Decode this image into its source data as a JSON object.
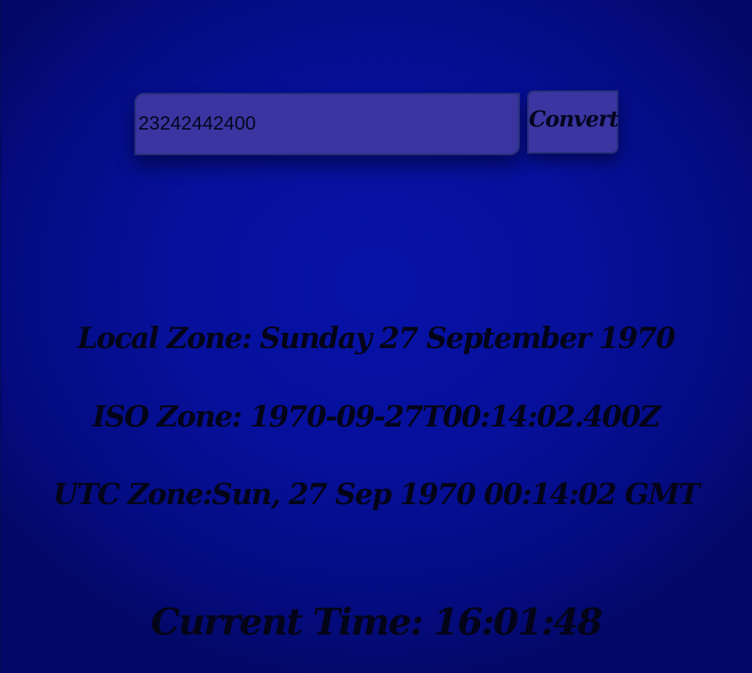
{
  "converter": {
    "input_value": "23242442400",
    "convert_label": "Convert"
  },
  "results": {
    "local_zone": "Local Zone: Sunday 27 September 1970",
    "iso_zone": "ISO Zone: 1970-09-27T00:14:02.400Z",
    "utc_zone": "UTC Zone:Sun, 27 Sep 1970 00:14:02 GMT"
  },
  "clock": {
    "current_time": "Current Time: 16:01:48"
  },
  "colors": {
    "background": "#06109a",
    "input_fill": "#3a35a0",
    "text": "#040418"
  }
}
